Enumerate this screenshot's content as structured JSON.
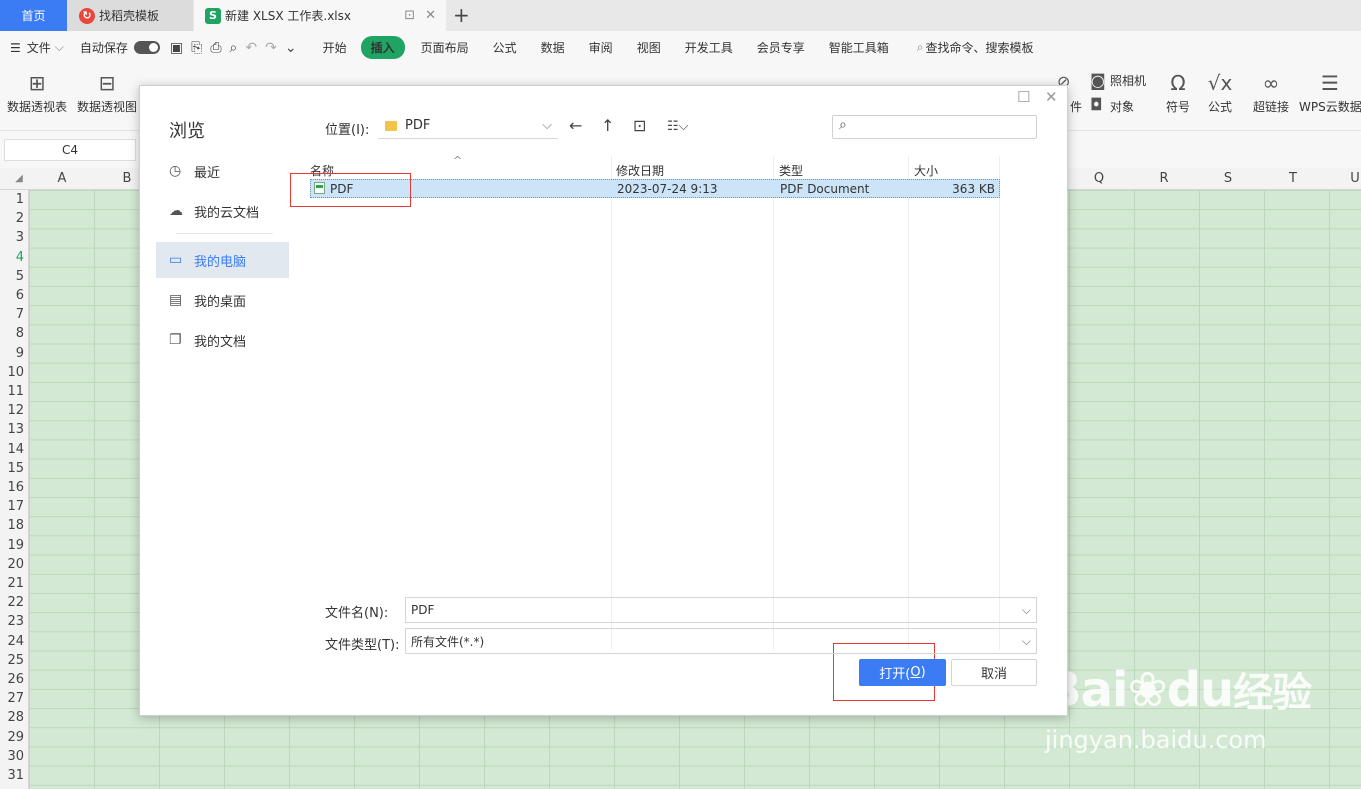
{
  "tabs": {
    "home": "首页",
    "template": "找稻壳模板",
    "workbook": "新建 XLSX 工作表.xlsx",
    "new_tab": "+"
  },
  "menu": {
    "file": "文件",
    "autosave": "自动保存",
    "items": [
      "开始",
      "插入",
      "页面布局",
      "公式",
      "数据",
      "审阅",
      "视图",
      "开发工具",
      "会员专享",
      "智能工具箱"
    ],
    "active_item": "插入",
    "search_hint": "查找命令、搜索模板"
  },
  "ribbon": {
    "pivot_table": "数据透视表",
    "pivot_chart": "数据透视图",
    "camera": "照相机",
    "object": "对象",
    "attachment_partial": "件",
    "symbol": "符号",
    "formula": "公式",
    "hyperlink": "超链接",
    "wps_cloud": "WPS云数据"
  },
  "name_box": "C4",
  "columns": [
    "A",
    "B",
    "Q",
    "R",
    "S",
    "T",
    "U"
  ],
  "rows": [
    "1",
    "2",
    "3",
    "4",
    "5",
    "6",
    "7",
    "8",
    "9",
    "10",
    "11",
    "12",
    "13",
    "14",
    "15",
    "16",
    "17",
    "18",
    "19",
    "20",
    "21",
    "22",
    "23",
    "24",
    "25",
    "26",
    "27",
    "28",
    "29",
    "30",
    "31"
  ],
  "dialog": {
    "title": "浏览",
    "sidebar": [
      "最近",
      "我的云文档",
      "我的电脑",
      "我的桌面",
      "我的文档"
    ],
    "active_sidebar": "我的电脑",
    "location_label": "位置(I):",
    "location_value": "PDF",
    "columns": [
      "名称",
      "修改日期",
      "类型",
      "大小"
    ],
    "files": [
      {
        "name": "PDF",
        "modified": "2023-07-24 9:13",
        "type": "PDF Document",
        "size": "363 KB"
      }
    ],
    "filename_label": "文件名(N):",
    "filename_value": "PDF",
    "filetype_label": "文件类型(T):",
    "filetype_value": "所有文件(*.*)",
    "open_label": "打开(",
    "open_accel": "O",
    "open_close": ")",
    "cancel_label": "取消"
  },
  "watermark": {
    "brand": "Bai",
    "brand2": "du",
    "cn": "经验",
    "url": "jingyan.baidu.com"
  },
  "colors": {
    "accent": "#3b7cf4",
    "insert_pill": "#1fa463",
    "sheet_bg": "#d3e9d3",
    "highlight_box": "#e53935"
  }
}
